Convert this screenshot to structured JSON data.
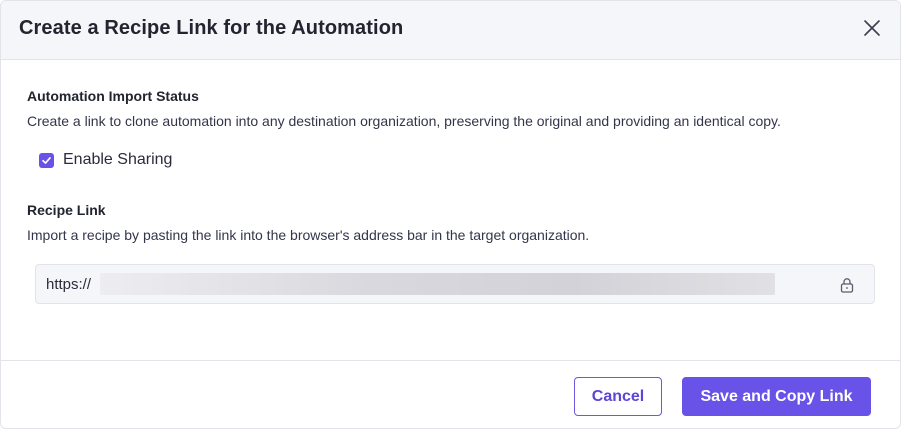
{
  "dialog": {
    "title": "Create a Recipe Link for the Automation"
  },
  "import_status": {
    "heading": "Automation Import Status",
    "description": "Create a link to clone automation into any destination organization, preserving the original and providing an identical copy.",
    "checkbox_label": "Enable Sharing",
    "checkbox_checked": true
  },
  "recipe_link": {
    "heading": "Recipe Link",
    "description": "Import a recipe by pasting the link into the browser's address bar in the target organization.",
    "value_prefix": "https://"
  },
  "footer": {
    "cancel_label": "Cancel",
    "save_label": "Save and Copy Link"
  },
  "colors": {
    "accent": "#6952e8",
    "header_bg": "#f5f6fa",
    "border": "#e3e4ea"
  },
  "icons": {
    "close": "close-icon",
    "check": "check-icon",
    "lock": "lock-icon"
  }
}
